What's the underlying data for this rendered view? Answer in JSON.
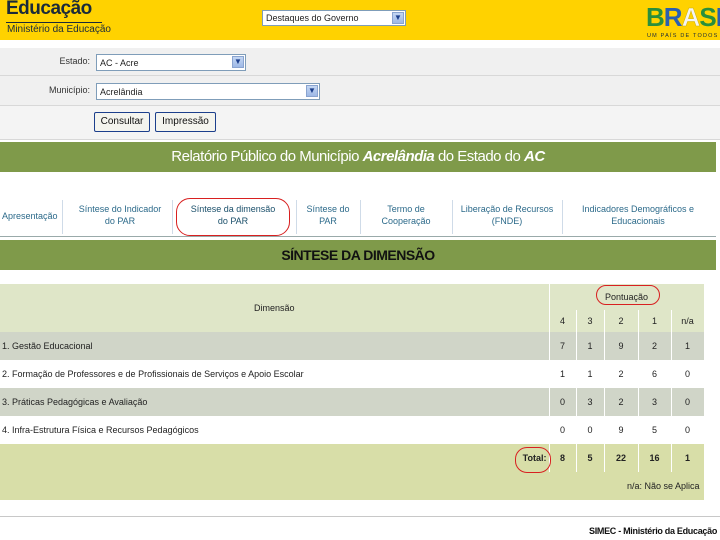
{
  "header": {
    "logo_title": "Educação",
    "logo_subtitle": "Ministério da Educação",
    "destaques_select": "Destaques do Governo",
    "brasil_logo_text": "BRASIL",
    "brasil_tagline": "UM PAÍS DE TODOS"
  },
  "filters": {
    "estado_label": "Estado:",
    "estado_value": "AC - Acre",
    "municipio_label": "Município:",
    "municipio_value": "Acrelândia",
    "consultar_label": "Consultar",
    "impressao_label": "Impressão"
  },
  "banner": {
    "prefix": "Relatório Público do Município ",
    "municipio": "Acrelândia",
    "middle": " do Estado do ",
    "estado": "AC"
  },
  "tabs": [
    {
      "line1": "Apresentação",
      "line2": ""
    },
    {
      "line1": "Síntese do Indicador",
      "line2": "do PAR"
    },
    {
      "line1": "Síntese da dimensão",
      "line2": "do PAR"
    },
    {
      "line1": "Síntese do",
      "line2": "PAR"
    },
    {
      "line1": "Termo de",
      "line2": "Cooperação"
    },
    {
      "line1": "Liberação de Recursos",
      "line2": "(FNDE)"
    },
    {
      "line1": "Indicadores Demográficos e",
      "line2": "Educacionais"
    }
  ],
  "active_tab_index": 2,
  "section_title": "SÍNTESE DA DIMENSÃO",
  "table": {
    "col_dimensao": "Dimensão",
    "col_pontuacao": "Pontuação",
    "score_cols": [
      "4",
      "3",
      "2",
      "1",
      "n/a"
    ],
    "rows": [
      {
        "name": "1. Gestão Educacional",
        "scores": [
          "7",
          "1",
          "9",
          "2",
          "1"
        ]
      },
      {
        "name": "2. Formação de Professores e de Profissionais de Serviços e Apoio Escolar",
        "scores": [
          "1",
          "1",
          "2",
          "6",
          "0"
        ]
      },
      {
        "name": "3. Práticas Pedagógicas e Avaliação",
        "scores": [
          "0",
          "3",
          "2",
          "3",
          "0"
        ]
      },
      {
        "name": "4. Infra-Estrutura Física e Recursos Pedagógicos",
        "scores": [
          "0",
          "0",
          "9",
          "5",
          "0"
        ]
      }
    ],
    "total_label": "Total:",
    "totals": [
      "8",
      "5",
      "22",
      "16",
      "1"
    ],
    "legend": "n/a: Não se Aplica"
  },
  "footer": "SIMEC - Ministério da Educação",
  "colors": {
    "header_yellow": "#ffd200",
    "banner_green": "#7f9a4a",
    "highlight_red": "#d82020"
  }
}
